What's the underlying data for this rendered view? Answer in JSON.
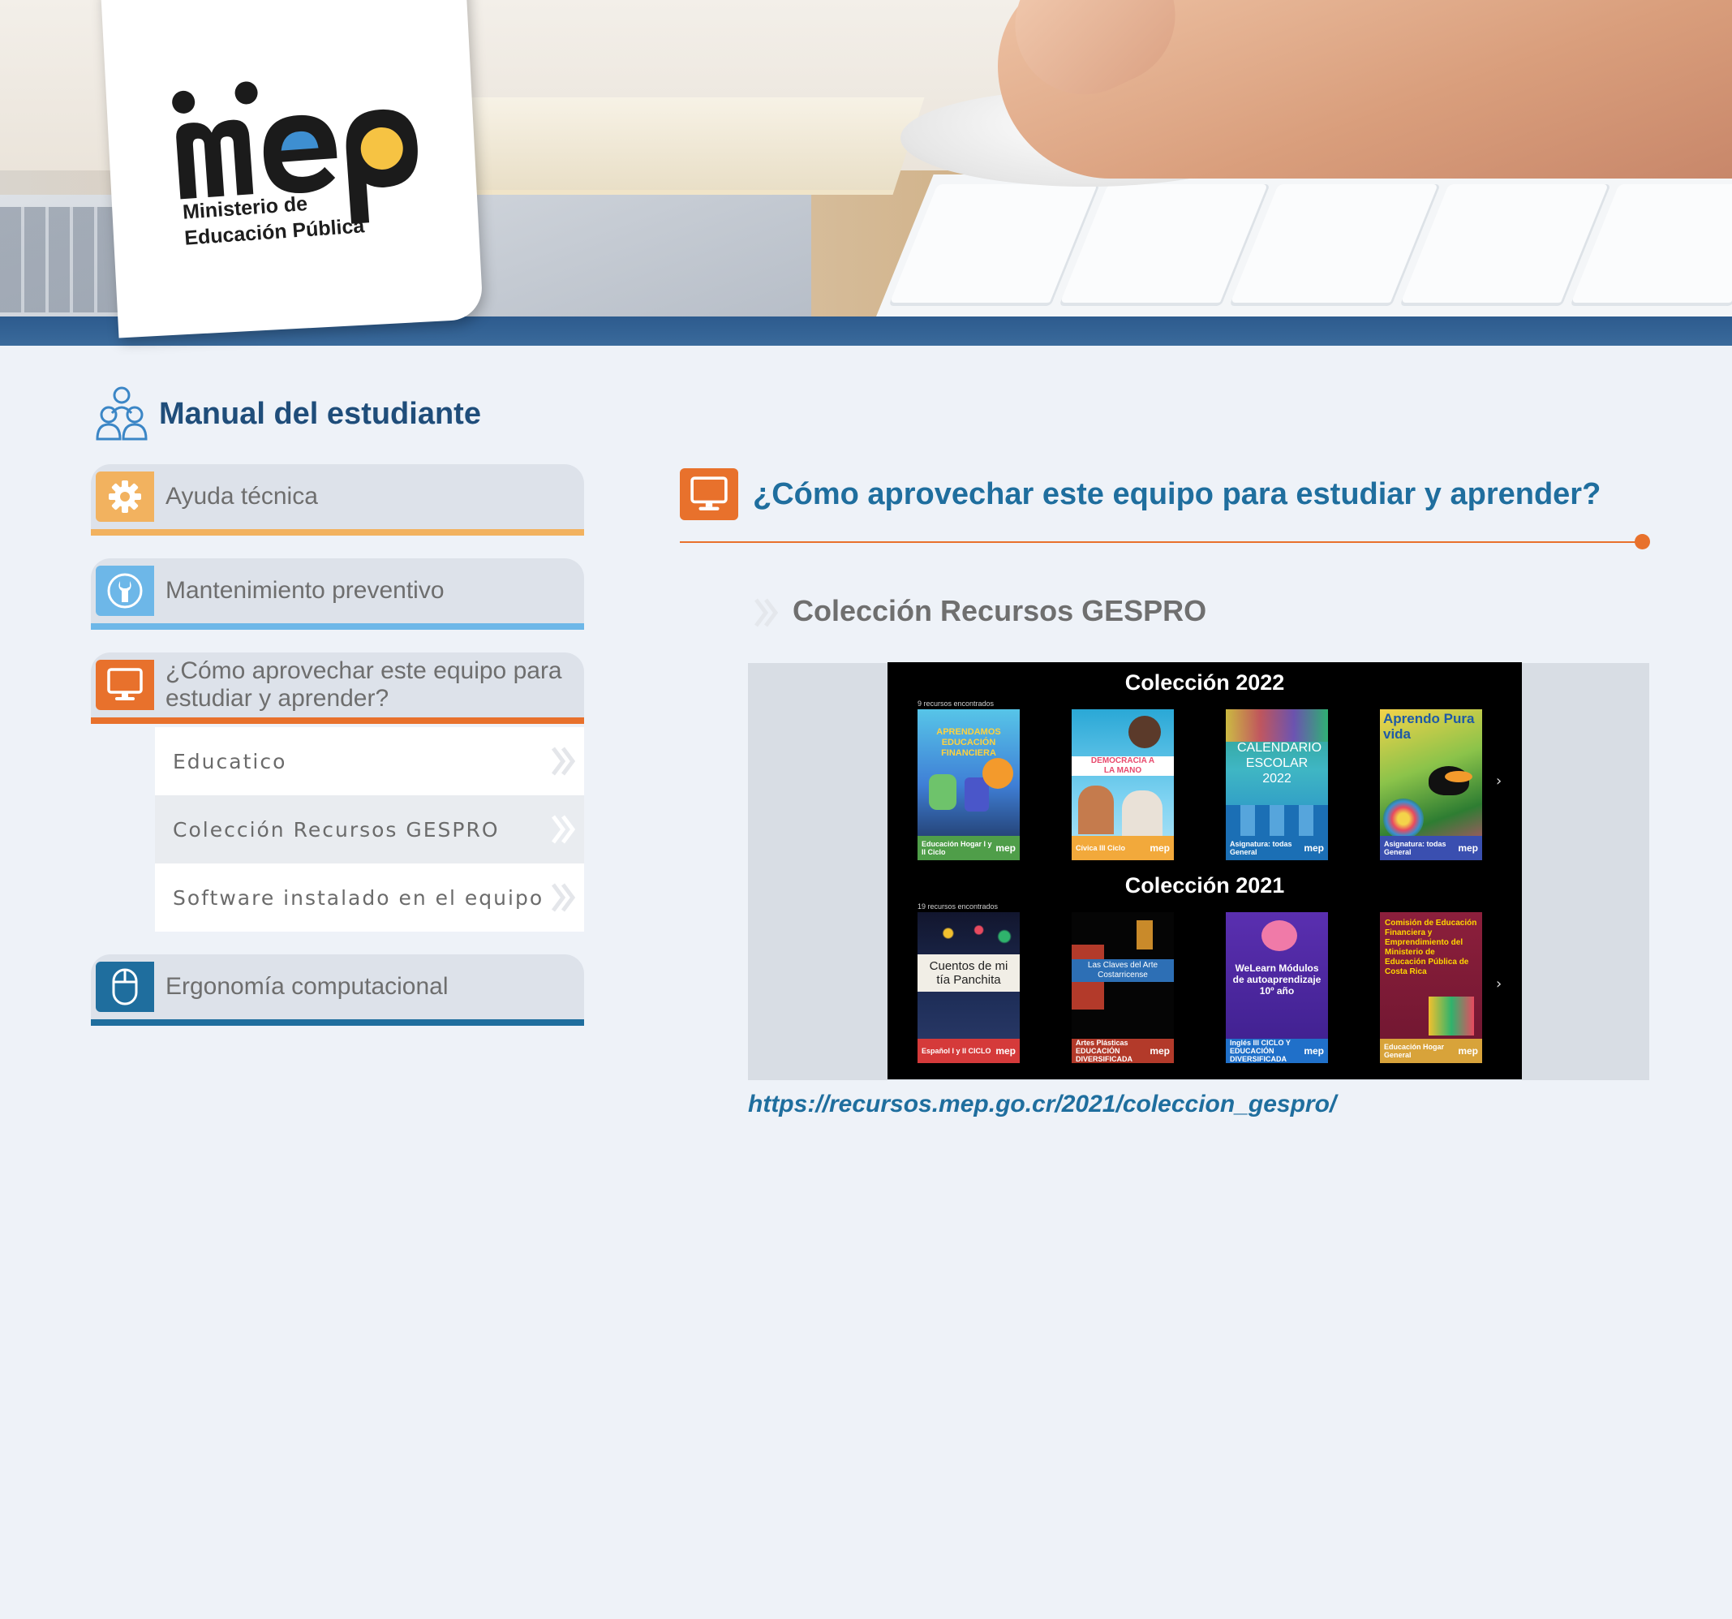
{
  "header": {
    "logo_word": "mep",
    "logo_line1": "Ministerio de",
    "logo_line2": "Educación Pública"
  },
  "sidebar": {
    "title": "Manual del estudiante",
    "items": [
      {
        "label": "Ayuda técnica",
        "icon": "gear-icon",
        "color": "#f2b25f"
      },
      {
        "label": "Mantenimiento preventivo",
        "icon": "wrench-icon",
        "color": "#6db7e8"
      },
      {
        "label": "¿Cómo aprovechar este equipo para estudiar y aprender?",
        "icon": "monitor-icon",
        "color": "#e8712c"
      },
      {
        "label": "Ergonomía computacional",
        "icon": "mouse-icon",
        "color": "#1f6e9e"
      }
    ],
    "sub_items": [
      {
        "label": "Educatico"
      },
      {
        "label": "Colección Recursos GESPRO"
      },
      {
        "label": "Software instalado en el equipo"
      }
    ]
  },
  "main": {
    "title": "¿Cómo aprovechar este equipo para estudiar y aprender?",
    "section_title": "Colección Recursos GESPRO",
    "link": "https://recursos.mep.go.cr/2021/coleccion_gespro/",
    "screenshot": {
      "collection_2022": {
        "title": "Colección 2022",
        "found": "9 recursos encontrados",
        "cards": [
          {
            "title": "APRENDAMOS EDUCACIÓN FINANCIERA",
            "foot": "Educación Hogar I y II Ciclo"
          },
          {
            "title": "DEMOCRACIA A LA MANO",
            "foot": "Cívica III Ciclo"
          },
          {
            "title": "CALENDARIO ESCOLAR 2022",
            "foot": "Asignatura: todas General"
          },
          {
            "title": "Aprendo Pura vida",
            "foot": "Asignatura: todas General"
          }
        ]
      },
      "collection_2021": {
        "title": "Colección 2021",
        "found": "19 recursos encontrados",
        "cards": [
          {
            "title": "Cuentos de mi tía Panchita",
            "foot": "Español I y II CICLO"
          },
          {
            "title": "Las Claves del Arte Costarricense",
            "foot": "Artes Plásticas EDUCACIÓN DIVERSIFICADA"
          },
          {
            "title": "WeLearn Módulos de autoaprendizaje 10º año",
            "foot": "Inglés III CICLO Y EDUCACIÓN DIVERSIFICADA"
          },
          {
            "title": "Comisión de Educación Financiera y Emprendimiento del Ministerio de Educación Pública de Costa Rica",
            "foot": "Educación Hogar General"
          }
        ]
      },
      "card_logo": "mep"
    }
  }
}
